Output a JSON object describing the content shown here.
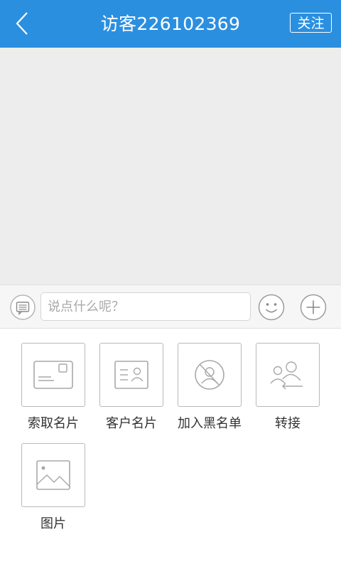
{
  "header": {
    "title": "访客226102369",
    "follow_label": "关注",
    "background": "#2b8fe0"
  },
  "input": {
    "placeholder": "说点什么呢？"
  },
  "icons": {
    "back": "chevron-left-icon",
    "keyboard": "message-icon",
    "emoji": "smiley-icon",
    "more": "plus-circle-icon"
  },
  "actions": [
    {
      "label": "索取名片",
      "icon": "card-icon"
    },
    {
      "label": "客户名片",
      "icon": "contact-card-icon"
    },
    {
      "label": "加入黑名单",
      "icon": "block-user-icon"
    },
    {
      "label": "转接",
      "icon": "transfer-users-icon"
    },
    {
      "label": "图片",
      "icon": "image-icon"
    }
  ]
}
